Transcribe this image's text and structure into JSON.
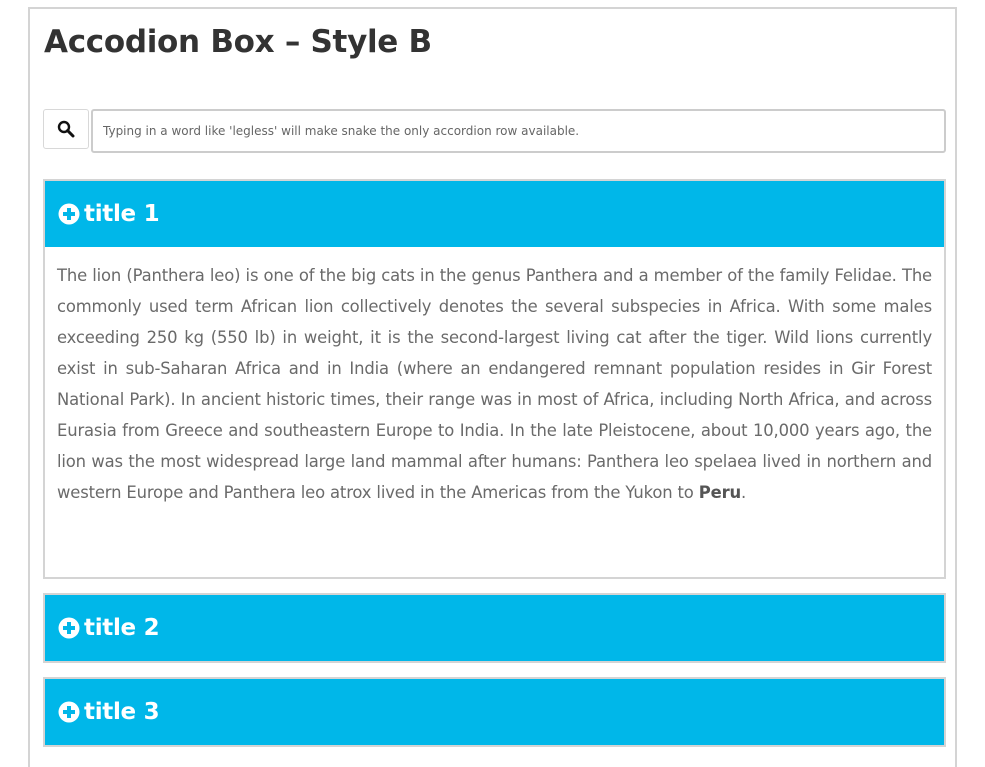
{
  "page": {
    "title": "Accodion Box – Style B"
  },
  "search": {
    "icon": "search-icon",
    "placeholder": "Typing in a word like 'legless' will make snake the only accordion row available.",
    "value": ""
  },
  "accordion": {
    "header_color": "#00b7e9",
    "items": [
      {
        "title": "title 1",
        "expanded": true,
        "body": "The lion (Panthera leo) is one of the big cats in the genus Panthera and a member of the family Felidae. The commonly used term African lion collectively denotes the several subspecies in Africa. With some males exceeding 250 kg (550 lb) in weight, it is the second-largest living cat after the tiger. Wild lions currently exist in sub-Saharan Africa and in India (where an endangered remnant population resides in Gir Forest National Park). In ancient historic times, their range was in most of Africa, including North Africa, and across Eurasia from Greece and southeastern Europe to India. In the late Pleistocene, about 10,000 years ago, the lion was the most widespread large land mammal after humans: Panthera leo spelaea lived in northern and western Europe and Panthera leo atrox lived in the Americas from the Yukon to ",
        "body_bold": "Peru",
        "body_end": "."
      },
      {
        "title": "title 2",
        "expanded": false
      },
      {
        "title": "title 3",
        "expanded": false
      }
    ]
  }
}
